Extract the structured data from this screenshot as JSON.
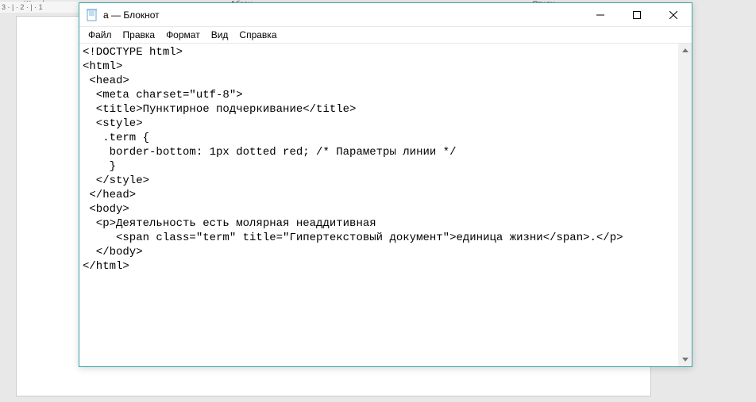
{
  "background": {
    "ruler_text": "3 · | · 2 · | · 1",
    "label_font": "Шрифт",
    "label_center": "Абзац",
    "label_right": "Стили"
  },
  "window": {
    "title": "а — Блокнот"
  },
  "menu": {
    "file": "Файл",
    "edit": "Правка",
    "format": "Формат",
    "view": "Вид",
    "help": "Справка"
  },
  "content": {
    "text": "<!DOCTYPE html>\n<html>\n <head>\n  <meta charset=\"utf-8\">\n  <title>Пунктирное подчеркивание</title>\n  <style>\n   .term {\n    border-bottom: 1px dotted red; /* Параметры линии */\n    }\n  </style>\n </head>\n <body>\n  <p>Деятельность есть молярная неаддитивная\n     <span class=\"term\" title=\"Гипертекстовый документ\">единица жизни</span>.</p>\n  </body>\n</html>"
  }
}
